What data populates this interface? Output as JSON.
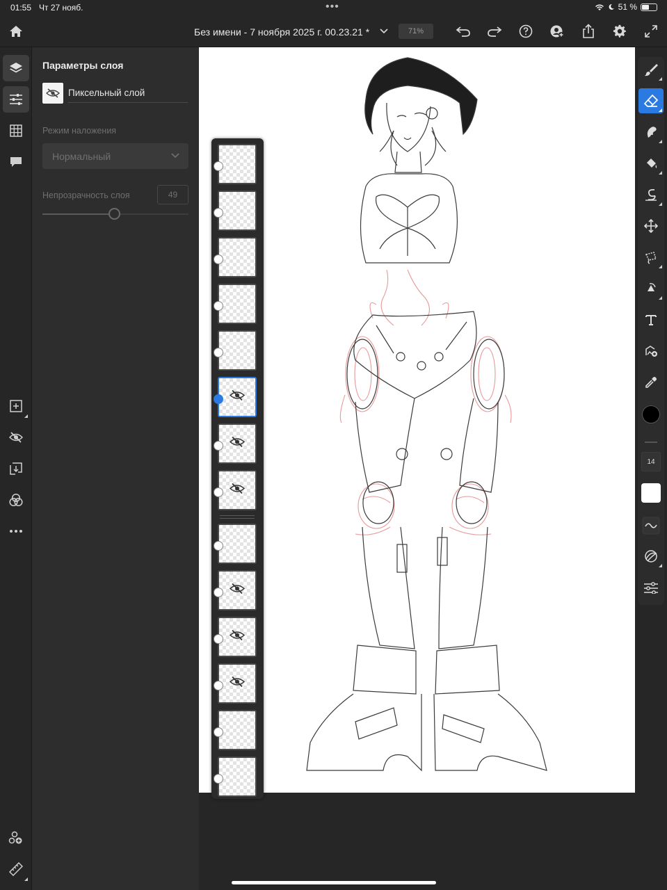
{
  "status_bar": {
    "time": "01:55",
    "date": "Чт 27 нояб.",
    "battery_percent": "51 %",
    "battery_level": 0.51
  },
  "topbar": {
    "document_title": "Без имени - 7 ноября 2025 г. 00.23.21 *",
    "zoom": "71%",
    "icons": [
      "home-icon",
      "chevron-down-icon",
      "undo-icon",
      "redo-icon",
      "help-icon",
      "live-stream-icon",
      "share-icon",
      "settings-icon",
      "fullscreen-icon"
    ]
  },
  "left_toolbar": {
    "icons": [
      "layers-icon",
      "layer-properties-icon",
      "grid-icon",
      "comments-icon",
      "add-layer-icon",
      "visibility-icon",
      "merge-down-icon",
      "blend-icon",
      "more-icon",
      "assets-icon",
      "ruler-icon"
    ]
  },
  "layer_properties": {
    "title": "Параметры слоя",
    "layer_name": "Пиксельный слой",
    "blend_mode_label": "Режим наложения",
    "blend_mode_value": "Нормальный",
    "opacity_label": "Непрозрачность слоя",
    "opacity_value": "49",
    "opacity_fraction": 0.49
  },
  "layers": [
    {
      "name": "layer-1",
      "hidden": false,
      "selected": false
    },
    {
      "name": "layer-2",
      "hidden": false,
      "selected": false
    },
    {
      "name": "layer-3",
      "hidden": false,
      "selected": false
    },
    {
      "name": "layer-4",
      "hidden": false,
      "selected": false
    },
    {
      "name": "layer-5",
      "hidden": false,
      "selected": false
    },
    {
      "name": "layer-6",
      "hidden": true,
      "selected": true
    },
    {
      "name": "layer-7",
      "hidden": true,
      "selected": false
    },
    {
      "name": "layer-8",
      "hidden": true,
      "selected": false
    },
    {
      "name": "layer-9",
      "hidden": false,
      "selected": false
    },
    {
      "name": "layer-10",
      "hidden": true,
      "selected": false
    },
    {
      "name": "layer-11",
      "hidden": true,
      "selected": false
    },
    {
      "name": "layer-12",
      "hidden": true,
      "selected": false
    },
    {
      "name": "layer-13",
      "hidden": false,
      "selected": false
    },
    {
      "name": "layer-14",
      "hidden": false,
      "selected": false
    }
  ],
  "right_toolbar": {
    "tools": [
      "brush-icon",
      "eraser-icon",
      "smudge-icon",
      "fill-icon",
      "liquify-icon",
      "move-icon",
      "lasso-icon",
      "transform-icon",
      "text-icon",
      "place-image-icon",
      "eyedropper-icon"
    ],
    "active_tool": "eraser-icon",
    "brush_size": "14",
    "primary_color": "#000000",
    "colors": {
      "accent": "#2a7ae2"
    }
  }
}
